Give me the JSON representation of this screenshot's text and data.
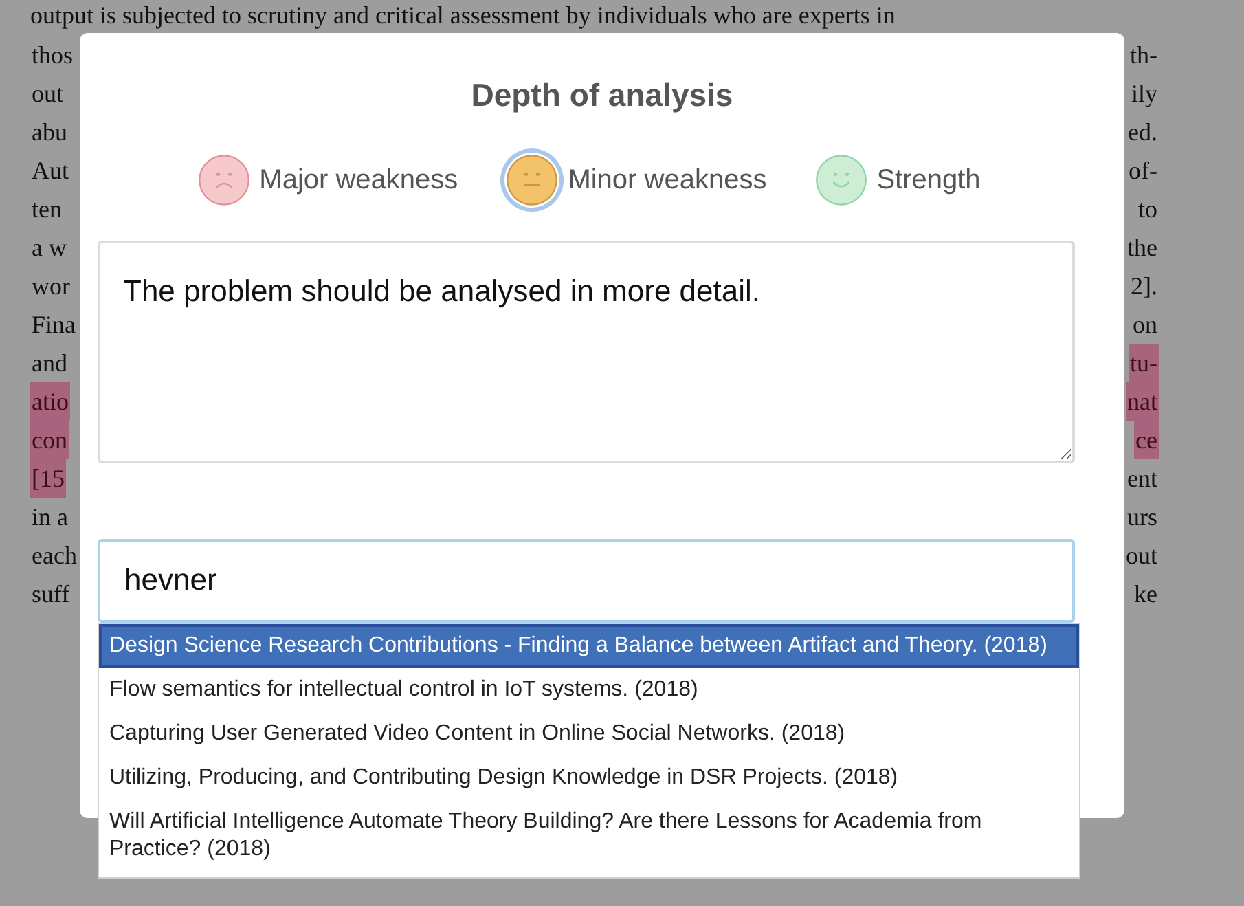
{
  "document": {
    "top_line": "output is subjected to scrutiny and critical assessment by individuals who are experts in",
    "lines": [
      {
        "left": {
          "text": "thos",
          "highlighted": false
        },
        "right": {
          "text": "th-",
          "highlighted": false
        }
      },
      {
        "left": {
          "text": "out",
          "highlighted": false
        },
        "right": {
          "text": "ily",
          "highlighted": false
        }
      },
      {
        "left": {
          "text": "abu",
          "highlighted": false
        },
        "right": {
          "text": "ed.",
          "highlighted": false
        }
      },
      {
        "left": {
          "text": "Aut",
          "highlighted": false
        },
        "right": {
          "text": "of-",
          "highlighted": false
        }
      },
      {
        "left": {
          "text": "ten",
          "highlighted": false
        },
        "right": {
          "text": "to",
          "highlighted": false
        }
      },
      {
        "left": {
          "text": "a w",
          "highlighted": false
        },
        "right": {
          "text": "the",
          "highlighted": false
        }
      },
      {
        "left": {
          "text": "wor",
          "highlighted": false
        },
        "right": {
          "text": "2].",
          "highlighted": false
        }
      },
      {
        "left": {
          "text": "Fina",
          "highlighted": false
        },
        "right": {
          "text": "on",
          "highlighted": false
        }
      },
      {
        "left": {
          "text": "and",
          "highlighted": false
        },
        "right": {
          "text": "tu-",
          "highlighted": true
        }
      },
      {
        "left": {
          "text": "atio",
          "highlighted": true
        },
        "right": {
          "text": "nat",
          "highlighted": true
        }
      },
      {
        "left": {
          "text": "con",
          "highlighted": true
        },
        "right": {
          "text": "ce",
          "highlighted": true
        }
      },
      {
        "left": {
          "text": "[15",
          "highlighted": true
        },
        "right": {
          "text": "ent",
          "highlighted": false
        }
      },
      {
        "left": {
          "text": "in a",
          "highlighted": false
        },
        "right": {
          "text": "urs",
          "highlighted": false
        }
      },
      {
        "left": {
          "text": "each",
          "highlighted": false
        },
        "right": {
          "text": "out",
          "highlighted": false
        }
      },
      {
        "left": {
          "text": "suff",
          "highlighted": false
        },
        "right": {
          "text": "ke",
          "highlighted": false
        }
      }
    ]
  },
  "dialog": {
    "title": "Depth of analysis",
    "ratings": [
      {
        "kind": "sad",
        "label": "Major weakness",
        "selected": false
      },
      {
        "kind": "neutral",
        "label": "Minor weakness",
        "selected": true
      },
      {
        "kind": "happy",
        "label": "Strength",
        "selected": false
      }
    ],
    "comment": {
      "value": "The problem should be analysed in more detail."
    },
    "search": {
      "value": "hevner"
    },
    "suggestions": [
      {
        "text": "Design Science Research Contributions - Finding a Balance between Artifact and Theory. (2018)",
        "selected": true
      },
      {
        "text": "Flow semantics for intellectual control in IoT systems. (2018)",
        "selected": false
      },
      {
        "text": "Capturing User Generated Video Content in Online Social Networks. (2018)",
        "selected": false
      },
      {
        "text": "Utilizing, Producing, and Contributing Design Knowledge in DSR Projects. (2018)",
        "selected": false
      },
      {
        "text": "Will Artificial Intelligence Automate Theory Building? Are there Lessons for Academia from Practice? (2018)",
        "selected": false
      }
    ]
  }
}
